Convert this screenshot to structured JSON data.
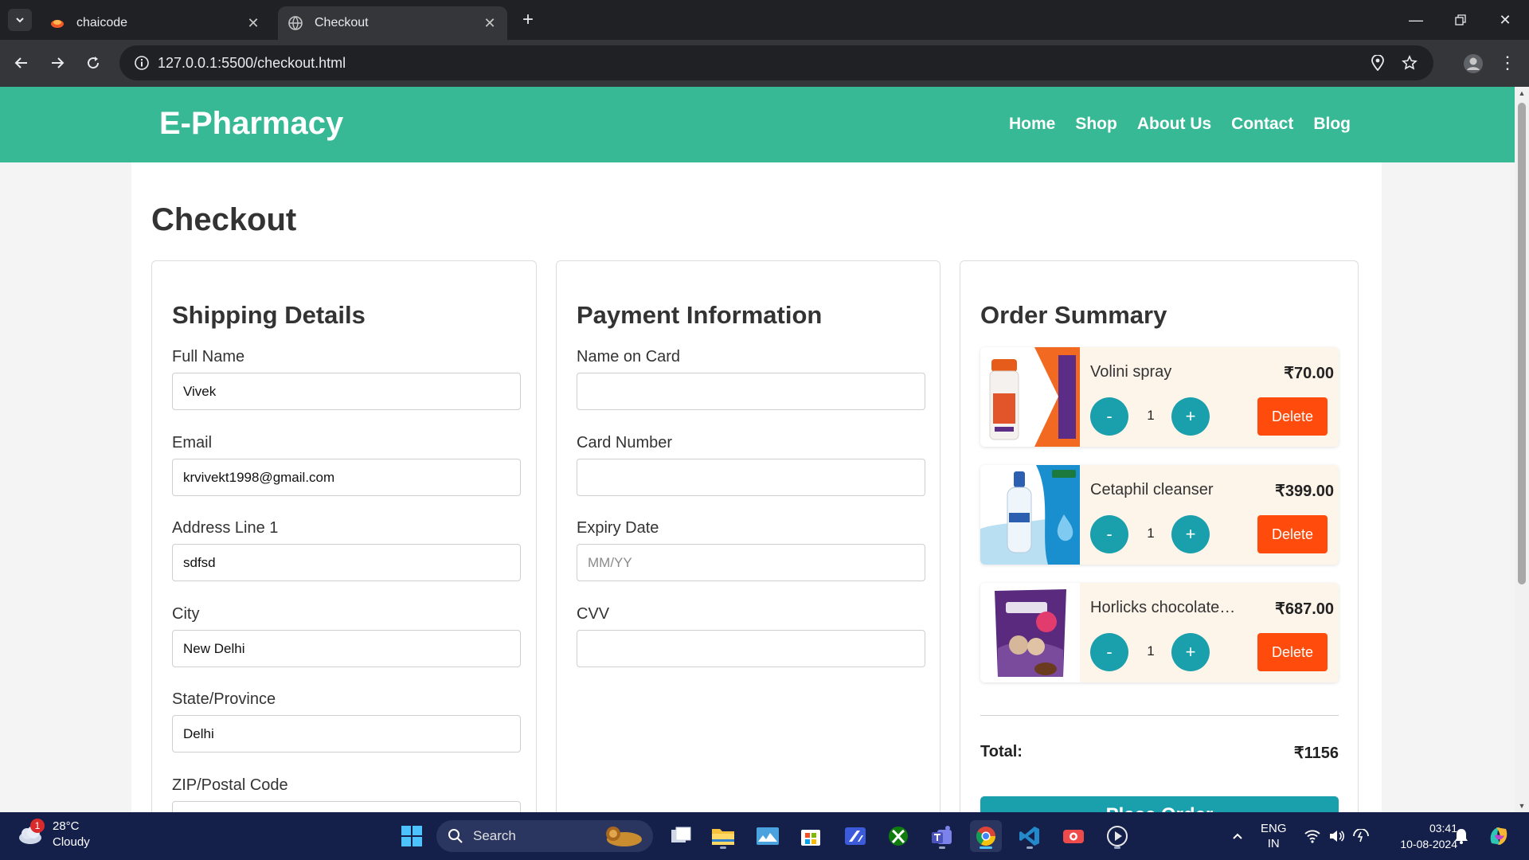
{
  "browser": {
    "tabs": [
      {
        "title": "chaicode",
        "active": false
      },
      {
        "title": "Checkout",
        "active": true
      }
    ],
    "url": "127.0.0.1:5500/checkout.html"
  },
  "site": {
    "brand": "E-Pharmacy",
    "nav": [
      "Home",
      "Shop",
      "About Us",
      "Contact",
      "Blog"
    ],
    "accent_color": "#38b996"
  },
  "page": {
    "title": "Checkout"
  },
  "shipping": {
    "heading": "Shipping Details",
    "fields": [
      {
        "label": "Full Name",
        "value": "Vivek"
      },
      {
        "label": "Email",
        "value": "krvivekt1998@gmail.com"
      },
      {
        "label": "Address Line 1",
        "value": "sdfsd"
      },
      {
        "label": "City",
        "value": "New Delhi"
      },
      {
        "label": "State/Province",
        "value": "Delhi"
      },
      {
        "label": "ZIP/Postal Code",
        "value": ""
      }
    ]
  },
  "payment": {
    "heading": "Payment Information",
    "fields": [
      {
        "label": "Name on Card",
        "value": "",
        "placeholder": ""
      },
      {
        "label": "Card Number",
        "value": "",
        "placeholder": ""
      },
      {
        "label": "Expiry Date",
        "value": "",
        "placeholder": "MM/YY"
      },
      {
        "label": "CVV",
        "value": "",
        "placeholder": ""
      }
    ]
  },
  "summary": {
    "heading": "Order Summary",
    "items": [
      {
        "name": "Volini spray",
        "price": "₹70.00",
        "qty": "1",
        "minus": "-",
        "plus": "+",
        "delete": "Delete"
      },
      {
        "name": "Cetaphil cleanser",
        "price": "₹399.00",
        "qty": "1",
        "minus": "-",
        "plus": "+",
        "delete": "Delete"
      },
      {
        "name": "Horlicks chocolate…",
        "price": "₹687.00",
        "qty": "1",
        "minus": "-",
        "plus": "+",
        "delete": "Delete"
      }
    ],
    "total_label": "Total:",
    "total_value": "₹1156",
    "place_order": "Place Order"
  },
  "taskbar": {
    "weather_temp": "28°C",
    "weather_desc": "Cloudy",
    "weather_badge": "1",
    "search": "Search",
    "lang": "ENG",
    "region": "IN",
    "time": "03:41",
    "date": "10-08-2024"
  }
}
